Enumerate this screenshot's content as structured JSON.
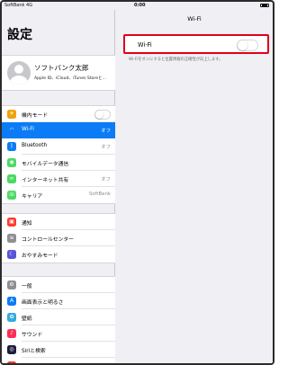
{
  "status_bar": {
    "carrier": "SoftBank  4G",
    "time": "0:00"
  },
  "master": {
    "title": "設定",
    "profile": {
      "name": "ソフトバンク太郎",
      "subtitle": "Apple ID、iCloud、iTunes Storeと..."
    },
    "group1": [
      {
        "label": "機内モード",
        "icon": "airplane-icon",
        "color": "#f0a30a",
        "glyph": "✈",
        "toggle": false
      },
      {
        "label": "Wi-Fi",
        "value": "オフ",
        "icon": "wifi-icon",
        "color": "#0b7cf6",
        "glyph": "◠",
        "selected": true
      },
      {
        "label": "Bluetooth",
        "value": "オフ",
        "icon": "bluetooth-icon",
        "color": "#0b7cf6",
        "glyph": "ᛒ"
      },
      {
        "label": "モバイルデータ通信",
        "icon": "cellular-icon",
        "color": "#4cd964",
        "glyph": "◉"
      },
      {
        "label": "インターネット共有",
        "value": "オフ",
        "icon": "hotspot-icon",
        "color": "#4cd964",
        "glyph": "∞"
      },
      {
        "label": "キャリア",
        "value": "SoftBank",
        "icon": "carrier-icon",
        "color": "#4cd964",
        "glyph": "☏"
      }
    ],
    "group2": [
      {
        "label": "通知",
        "icon": "notifications-icon",
        "color": "#ff3b30",
        "glyph": "▣"
      },
      {
        "label": "コントロールセンター",
        "icon": "control-center-icon",
        "color": "#8e8e93",
        "glyph": "≡"
      },
      {
        "label": "おやすみモード",
        "icon": "do-not-disturb-icon",
        "color": "#5856d6",
        "glyph": "☾"
      }
    ],
    "group3": [
      {
        "label": "一般",
        "icon": "general-icon",
        "color": "#8e8e93",
        "glyph": "⚙"
      },
      {
        "label": "画面表示と明るさ",
        "icon": "display-icon",
        "color": "#0b7cf6",
        "glyph": "A"
      },
      {
        "label": "壁紙",
        "icon": "wallpaper-icon",
        "color": "#34aadc",
        "glyph": "✿"
      },
      {
        "label": "サウンド",
        "icon": "sounds-icon",
        "color": "#ff2d55",
        "glyph": "♪"
      },
      {
        "label": "Siriと検索",
        "icon": "siri-icon",
        "color": "#1c1c3c",
        "glyph": "◎"
      },
      {
        "label": "パスコード",
        "icon": "passcode-icon",
        "color": "#ff3b30",
        "glyph": "▮"
      }
    ]
  },
  "detail": {
    "title": "Wi-Fi",
    "wifi_label": "Wi-Fi",
    "wifi_on": false,
    "footnote": "Wi-Fiをオンにすると位置情報の正確性が向上します。",
    "highlight_color": "#e0001b"
  }
}
